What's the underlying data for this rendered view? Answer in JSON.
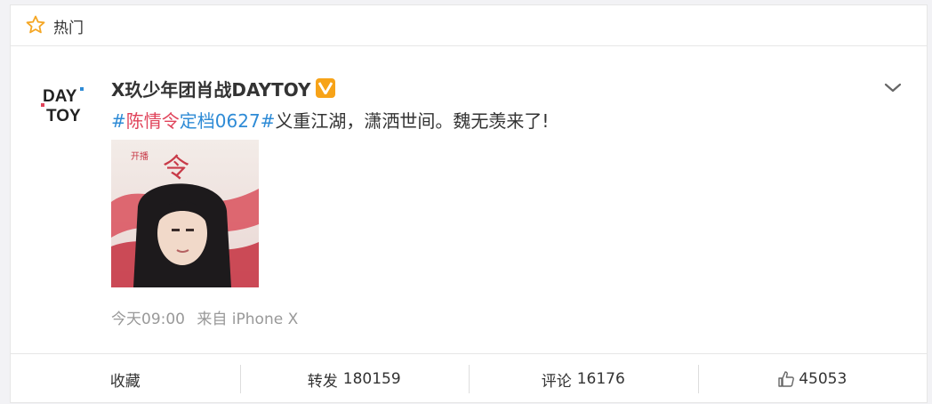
{
  "hot_section": {
    "label": "热门",
    "icon": "star-icon"
  },
  "post": {
    "author": "X玖少年团肖战DAYTOY",
    "verified_badge": "V",
    "avatar_text_top": "DAY",
    "avatar_text_bottom": "TOY",
    "text_parts": {
      "hash_open": "#",
      "tag_a": "陈情令",
      "tag_b": "定档0627",
      "hash_close": "#",
      "body": "义重江湖，潇洒世间。魏无羡来了!"
    },
    "image_caption_top": "开播",
    "image_caption_big": "令",
    "time": "今天09:00",
    "source": "来自 iPhone X"
  },
  "actions": {
    "favorite": "收藏",
    "repost_label": "转发",
    "repost_count": "180159",
    "comment_label": "评论",
    "comment_count": "16176",
    "like_count": "45053"
  },
  "colors": {
    "hashtag": "#2e8bd6",
    "hashtag_accent": "#e0435a",
    "verified": "#f7a318",
    "star": "#f5a623"
  }
}
